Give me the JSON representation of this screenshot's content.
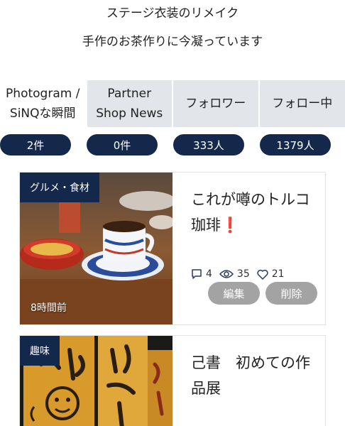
{
  "profile": {
    "bio_line1": "ステージ衣装のリメイク",
    "bio_line2": "手作のお茶作りに今凝っています"
  },
  "stats": [
    {
      "label_line1": "Photogram /",
      "label_line2": "SiNQな瞬間",
      "count": "2件",
      "active": true
    },
    {
      "label_line1": "Partner",
      "label_line2": "Shop News",
      "count": "0件",
      "active": false
    },
    {
      "label_line1": "フォロワー",
      "label_line2": "",
      "count": "333人",
      "active": false
    },
    {
      "label_line1": "フォロー中",
      "label_line2": "",
      "count": "1379人",
      "active": false
    }
  ],
  "posts": [
    {
      "category": "グルメ・食材",
      "time": "8時間前",
      "title": "これが噂のトルコ珈琲❗",
      "comments": "4",
      "views": "35",
      "likes": "21",
      "edit_label": "編集",
      "delete_label": "削除"
    },
    {
      "category": "趣味",
      "title": "己書　初めての作品展"
    }
  ],
  "colors": {
    "navy": "#14284b",
    "tab_bg": "#e2e6ea",
    "button_gray": "#a3a3a3",
    "heart_red": "#e53935"
  }
}
